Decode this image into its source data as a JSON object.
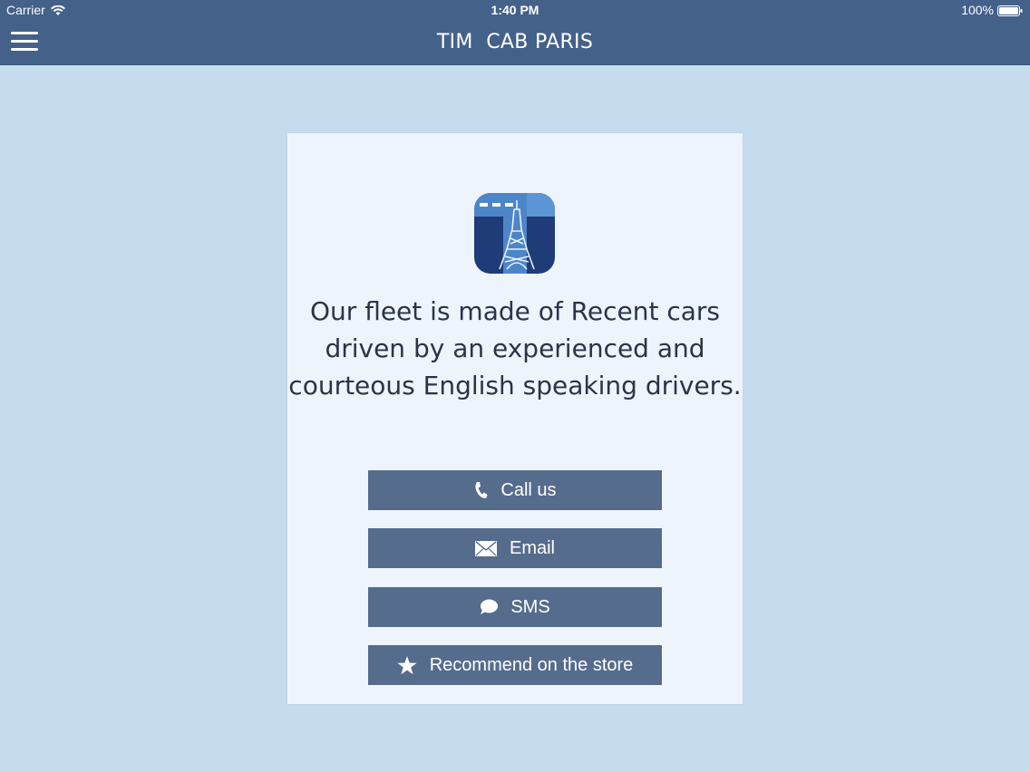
{
  "status_bar": {
    "carrier": "Carrier",
    "time": "1:40 PM",
    "battery": "100%"
  },
  "nav": {
    "title": "TIM  CAB PARIS",
    "menu_icon": "hamburger-menu-icon"
  },
  "card": {
    "logo_icon": "eiffel-tower-logo",
    "tagline": "Our fleet is made of Recent cars driven by an experienced and courteous English speaking drivers."
  },
  "actions": [
    {
      "label": "Call us",
      "icon": "phone-icon"
    },
    {
      "label": "Email",
      "icon": "envelope-icon"
    },
    {
      "label": "SMS",
      "icon": "speech-bubble-icon"
    },
    {
      "label": "Recommend on the store",
      "icon": "star-icon"
    }
  ],
  "colors": {
    "bar": "#44618a",
    "background": "#c5dcee",
    "card": "#eef4fb",
    "button": "#566c8d",
    "text": "#2b3447"
  }
}
